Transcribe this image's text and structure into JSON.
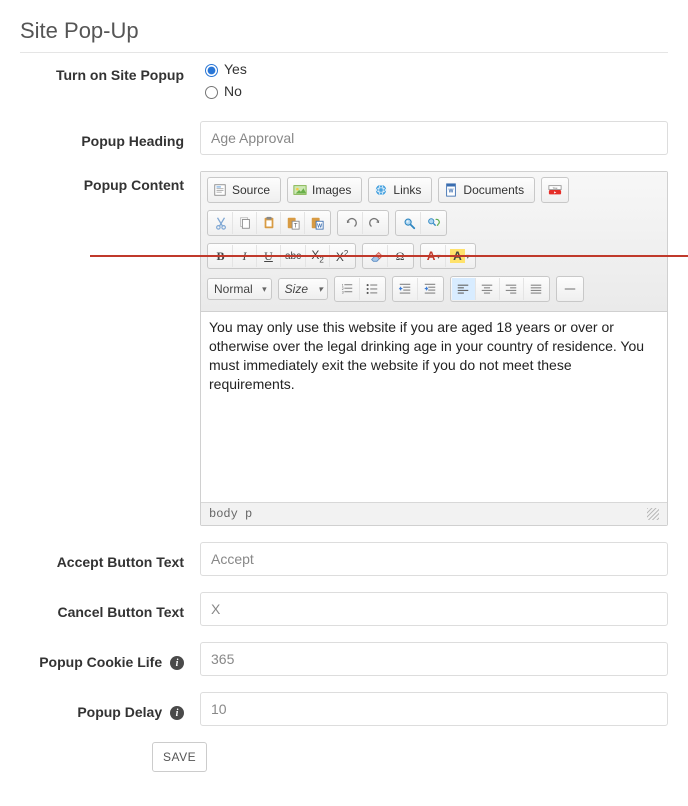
{
  "page": {
    "title": "Site Pop-Up"
  },
  "labels": {
    "turn_on": "Turn on Site Popup",
    "heading": "Popup Heading",
    "content": "Popup Content",
    "accept_btn": "Accept Button Text",
    "cancel_btn": "Cancel Button Text",
    "cookie_life": "Popup Cookie Life",
    "delay": "Popup Delay",
    "save": "SAVE"
  },
  "turn_on": {
    "selected": "yes",
    "options": {
      "yes": "Yes",
      "no": "No"
    }
  },
  "fields": {
    "heading": "Age Approval",
    "accept": "Accept",
    "cancel": "X",
    "cookie_life": "365",
    "delay": "10"
  },
  "editor": {
    "buttons": {
      "source": "Source",
      "images": "Images",
      "links": "Links",
      "documents": "Documents"
    },
    "format_select": "Normal",
    "size_select": "Size",
    "body_text": "You may only use this website if you are aged 18 years or over or otherwise over the legal drinking age in your country of residence. You must immediately exit the website if you do not meet these requirements.",
    "path": "body  p"
  }
}
